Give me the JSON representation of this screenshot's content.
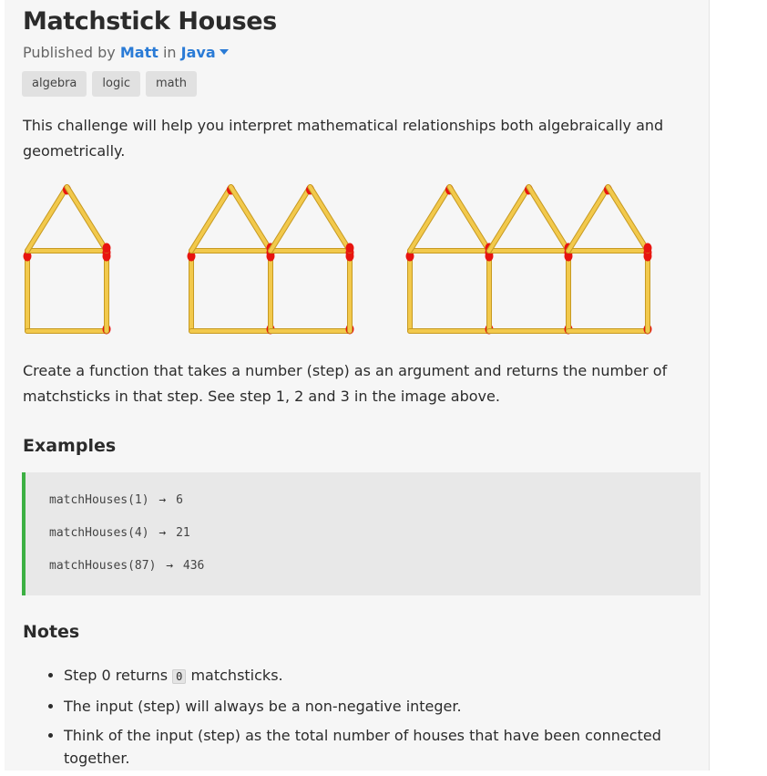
{
  "challenge": {
    "title": "Matchstick Houses",
    "published_prefix": "Published by",
    "author": "Matt",
    "in_word": "in",
    "language": "Java"
  },
  "tags": [
    "algebra",
    "logic",
    "math"
  ],
  "intro": "This challenge will help you interpret mathematical relationships both algebraically and geometrically.",
  "illustration": {
    "steps": [
      1,
      2,
      3
    ],
    "match_color": "#f2c94c",
    "head_color": "#e8140f"
  },
  "task": "Create a function that takes a number (step) as an argument and returns the number of matchsticks in that step. See step 1, 2 and 3 in the image above.",
  "examples": {
    "heading": "Examples",
    "arrow": "→",
    "items": [
      {
        "call": "matchHouses(1)",
        "result": "6"
      },
      {
        "call": "matchHouses(4)",
        "result": "21"
      },
      {
        "call": "matchHouses(87)",
        "result": "436"
      }
    ]
  },
  "notes": {
    "heading": "Notes",
    "item1_prefix": "Step 0 returns",
    "item1_code": "0",
    "item1_suffix": "matchsticks.",
    "item2": "The input (step) will always be a non-negative integer.",
    "item3": "Think of the input (step) as the total number of houses that have been connected together."
  }
}
